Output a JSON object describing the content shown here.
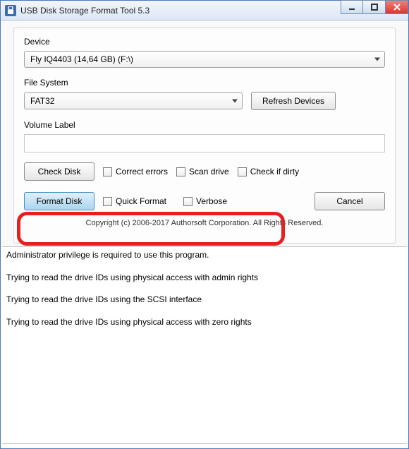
{
  "window": {
    "title": "USB Disk Storage Format Tool 5.3"
  },
  "labels": {
    "device": "Device",
    "filesystem": "File System",
    "volume_label": "Volume Label"
  },
  "device": {
    "selected": "Fly  IQ4403   (14,64 GB) (F:\\)"
  },
  "filesystem": {
    "selected": "FAT32"
  },
  "volume_label_value": "",
  "buttons": {
    "refresh": "Refresh Devices",
    "check_disk": "Check Disk",
    "format_disk": "Format Disk",
    "cancel": "Cancel"
  },
  "checkboxes": {
    "correct_errors": "Correct errors",
    "scan_drive": "Scan drive",
    "check_if_dirty": "Check if dirty",
    "quick_format": "Quick Format",
    "verbose": "Verbose"
  },
  "copyright": "Copyright (c) 2006-2017 Authorsoft Corporation. All Rights Reserved.",
  "log": [
    "Administrator privilege is required to use this program.",
    "Trying to read the drive IDs using physical access with admin rights",
    "Trying to read the drive IDs using the SCSI interface",
    "Trying to read the drive IDs using physical access with zero rights"
  ]
}
